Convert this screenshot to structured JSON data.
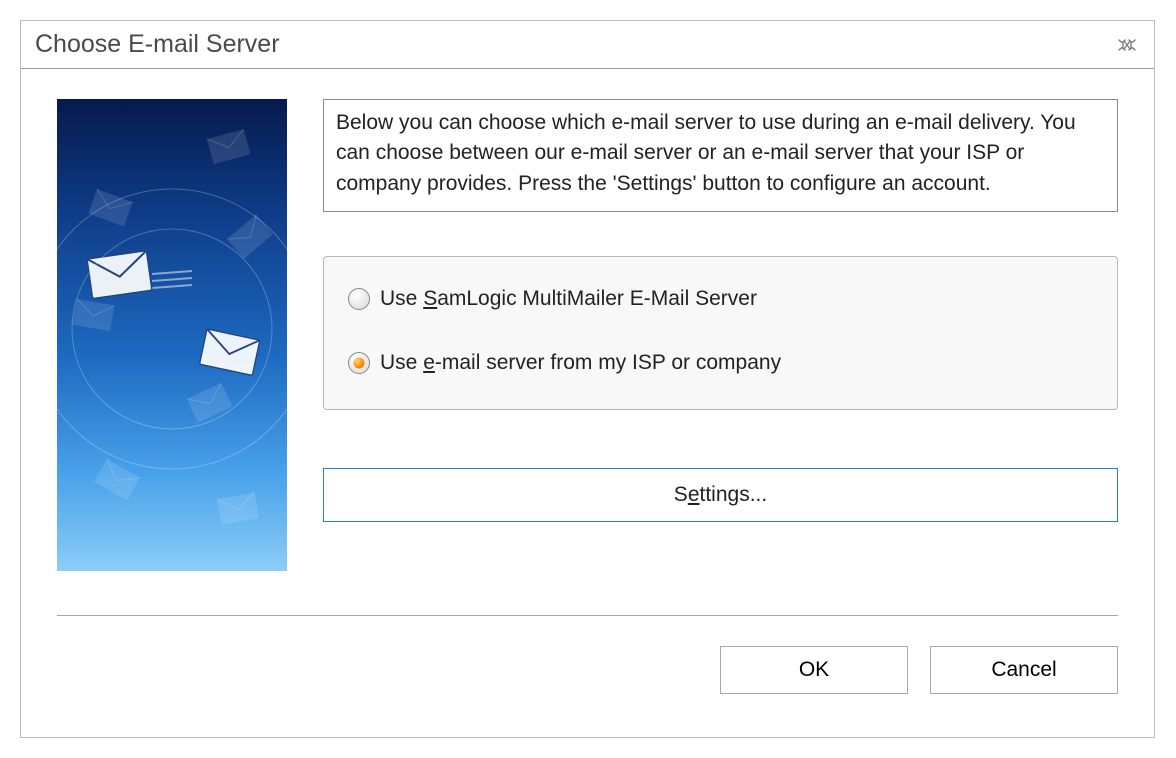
{
  "dialog": {
    "title": "Choose E-mail Server",
    "close_icon": "close"
  },
  "info_text": "Below you can choose which e-mail server to use during an e-mail delivery. You can choose between our e-mail server or an e-mail server that your ISP or company provides. Press the 'Settings' button to configure an account.",
  "radios": {
    "option1_prefix": "Use ",
    "option1_mnemonic": "S",
    "option1_rest": "amLogic MultiMailer E-Mail Server",
    "option2_prefix": "Use ",
    "option2_mnemonic": "e",
    "option2_rest": "-mail server from my ISP or company",
    "selected": "option2"
  },
  "buttons": {
    "settings_prefix": "S",
    "settings_mnemonic": "e",
    "settings_rest": "ttings...",
    "ok": "OK",
    "cancel": "Cancel"
  }
}
